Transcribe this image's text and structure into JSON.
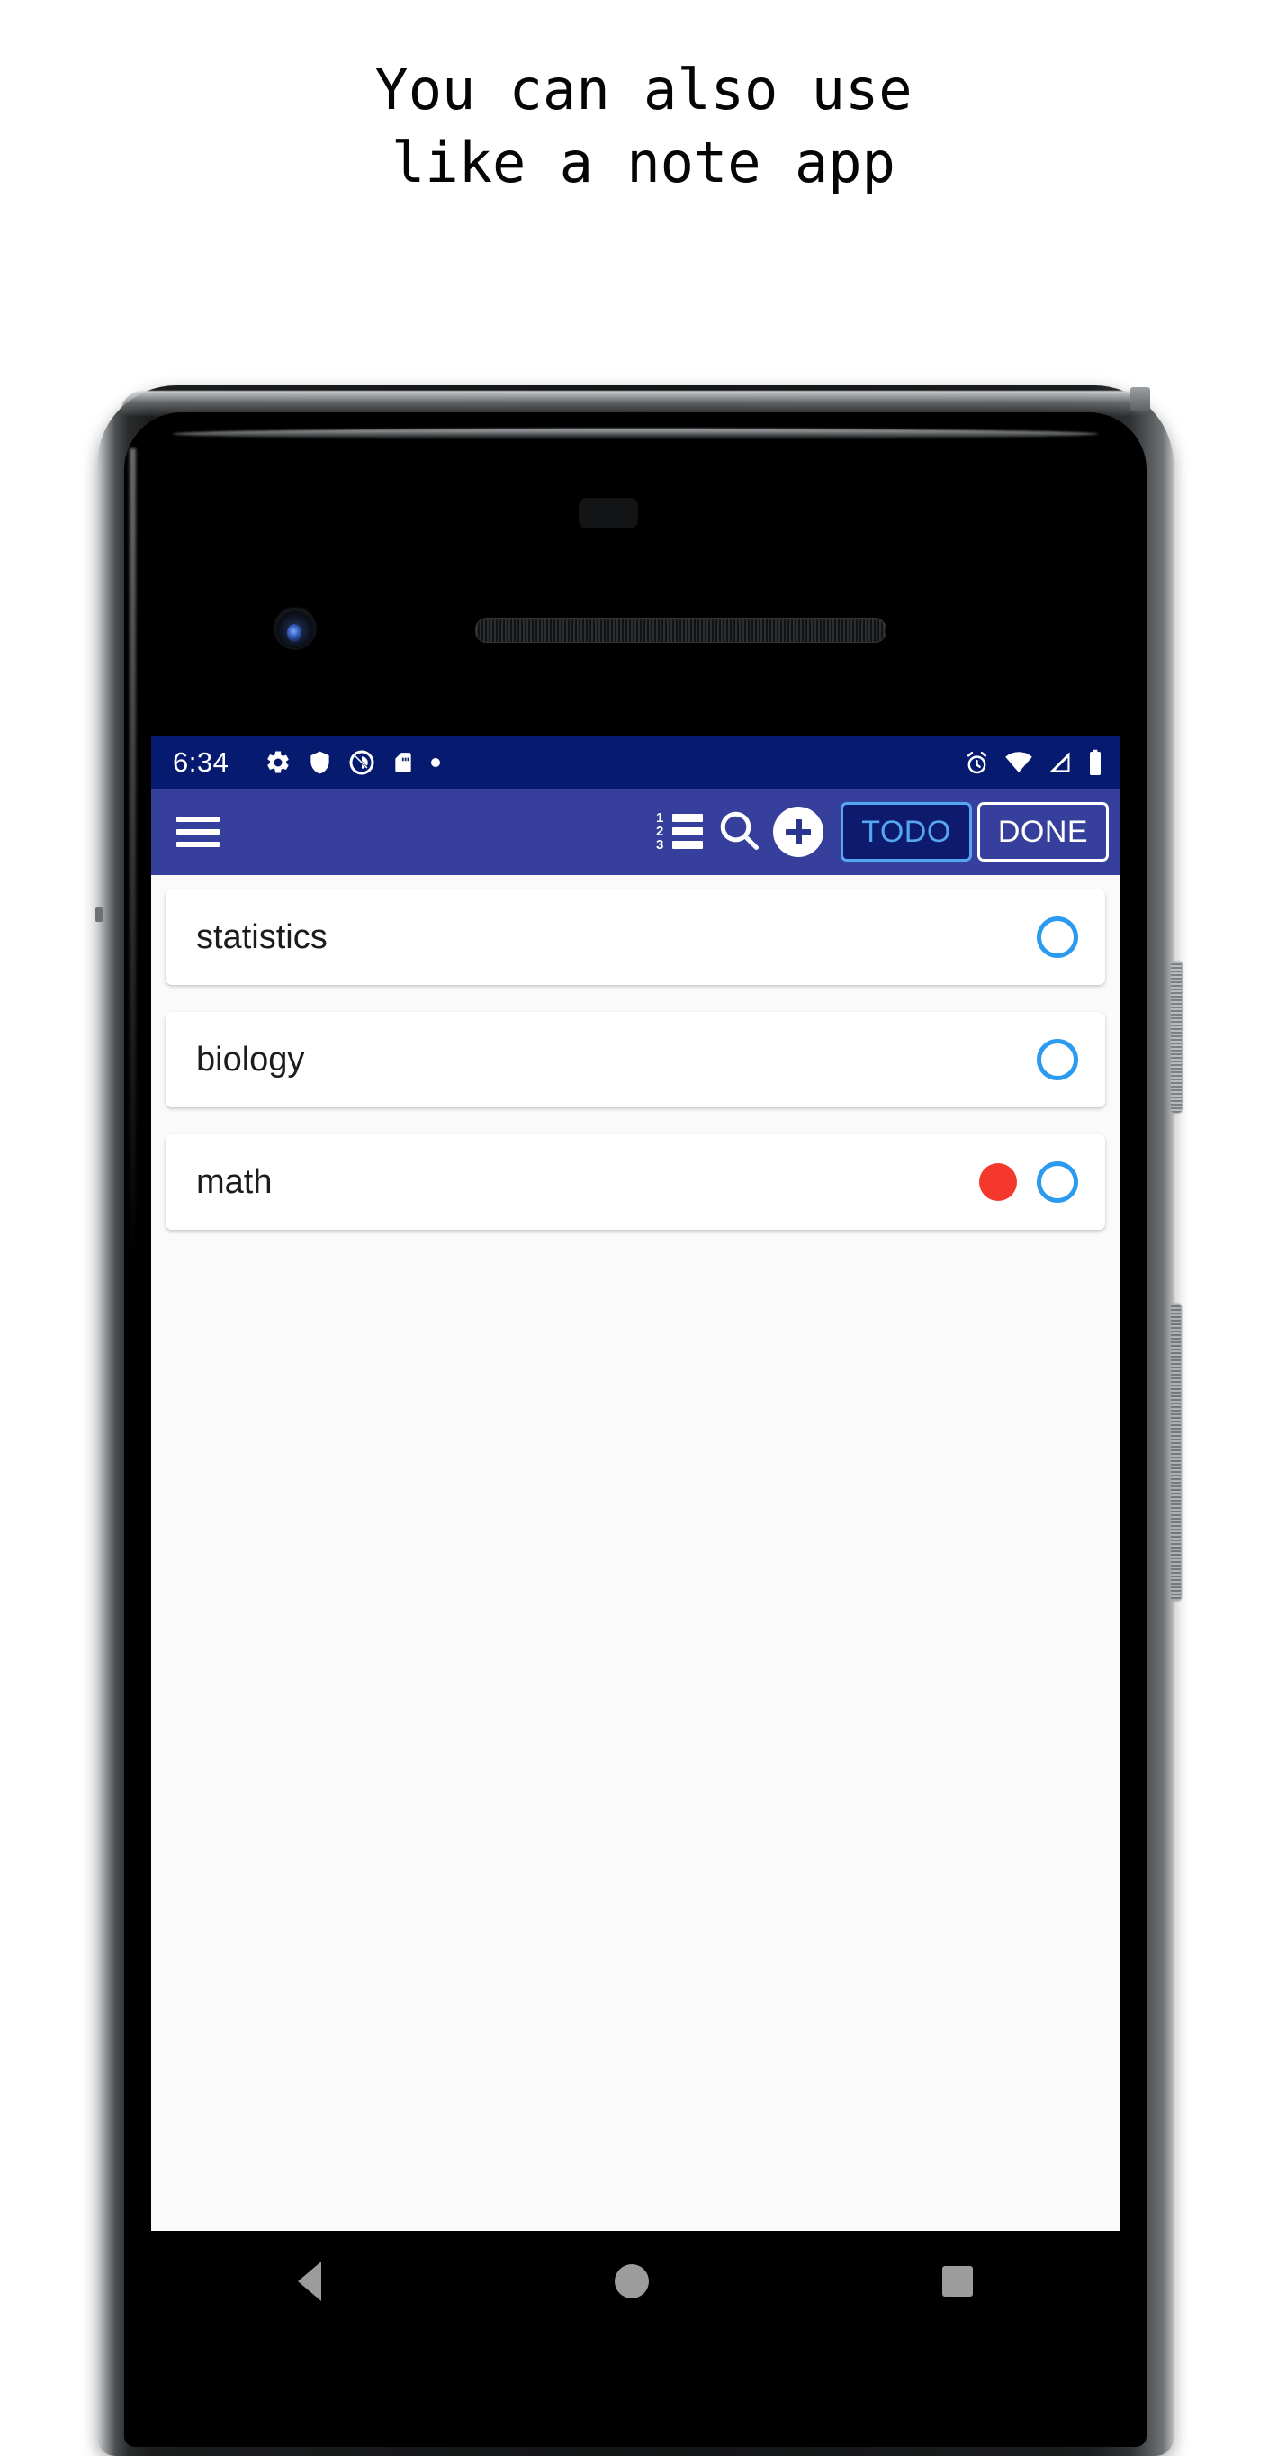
{
  "caption": {
    "line1": "You can also use",
    "line2": "like a note app"
  },
  "colors": {
    "status_bar": "#061a70",
    "app_bar": "#36409c",
    "tab_active_bg": "#0d1a6e",
    "tab_active_fg": "#55a6f0",
    "tab_inactive_fg": "#ffffff",
    "priority_red": "#f4392c",
    "check_blue": "#2b9bf0",
    "list_bg": "#fafafa",
    "card_bg": "#ffffff"
  },
  "status_bar": {
    "time": "6:34",
    "left_icons": [
      "gear-icon",
      "shield-icon",
      "do-not-disturb-icon",
      "sd-card-icon",
      "dot-icon"
    ],
    "right_icons": [
      "alarm-icon",
      "wifi-icon",
      "signal-icon",
      "battery-icon"
    ]
  },
  "app_bar": {
    "menu_icon": "hamburger-menu-icon",
    "sort_icon": "numbered-list-icon",
    "sort_digits": [
      "1",
      "2",
      "3"
    ],
    "search_icon": "search-icon",
    "add_icon": "plus-icon",
    "tabs": [
      {
        "label": "TODO",
        "active": true
      },
      {
        "label": "DONE",
        "active": false
      }
    ]
  },
  "list": {
    "items": [
      {
        "title": "statistics",
        "has_priority": false,
        "checked": false
      },
      {
        "title": "biology",
        "has_priority": false,
        "checked": false
      },
      {
        "title": "math",
        "has_priority": true,
        "checked": false
      }
    ]
  },
  "nav_bar": {
    "back": "back-triangle-icon",
    "home": "home-circle-icon",
    "recents": "recents-square-icon"
  },
  "device": {
    "front_camera": "front-camera",
    "earpiece": "earpiece-speaker",
    "power_button": "power-button",
    "volume_button": "volume-rocker"
  }
}
